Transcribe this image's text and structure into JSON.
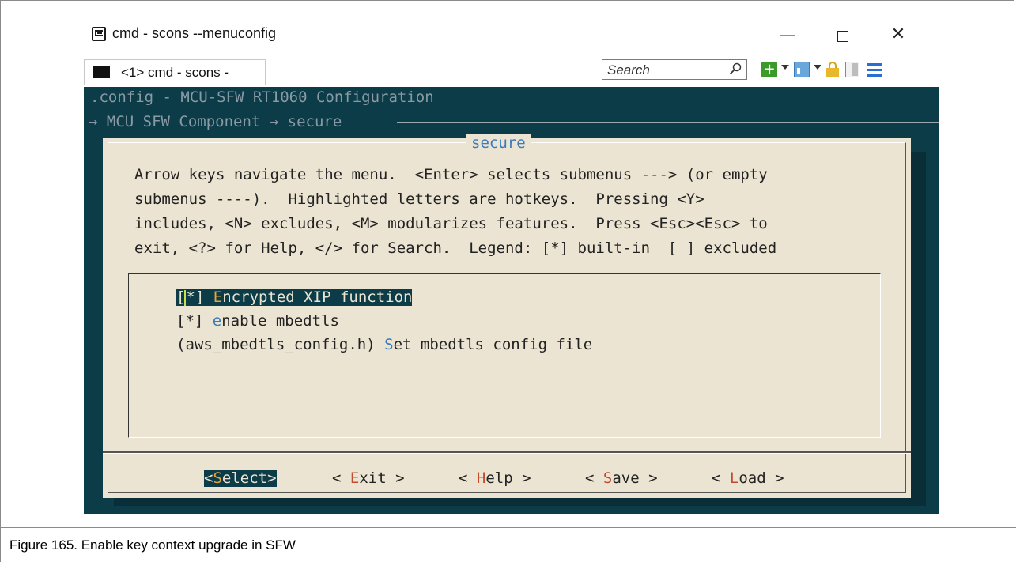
{
  "window": {
    "title": "cmd - scons  --menuconfig",
    "controls": {
      "minimize": "—",
      "maximize": "",
      "close": "✕"
    }
  },
  "tab": {
    "label": "<1>  cmd - scons  -"
  },
  "search": {
    "placeholder": "Search"
  },
  "terminal": {
    "config_line": ".config - MCU-SFW RT1060 Configuration",
    "path_line": "→ MCU SFW Component → secure",
    "dialog_title": "secure",
    "help_lines": [
      "Arrow keys navigate the menu.  <Enter> selects submenus ---> (or empty",
      "submenus ----).  Highlighted letters are hotkeys.  Pressing <Y>",
      "includes, <N> excludes, <M> modularizes features.  Press <Esc><Esc> to",
      "exit, <?> for Help, </> for Search.  Legend: [*] built-in  [ ] excluded"
    ],
    "menu_items": [
      {
        "prefix": "[*] ",
        "hotkey": "E",
        "rest": "ncrypted XIP function",
        "selected": true
      },
      {
        "prefix": "[*] ",
        "hotkey": "e",
        "rest": "nable mbedtls",
        "selected": false
      },
      {
        "prefix": "(aws_mbedtls_config.h) ",
        "hotkey": "S",
        "rest": "et mbedtls config file",
        "selected": false
      }
    ],
    "buttons": [
      {
        "open": "<",
        "hotkey": "S",
        "rest": "elect",
        "close": ">"
      },
      {
        "open": "< ",
        "hotkey": "E",
        "rest": "xit",
        "close": " >"
      },
      {
        "open": "< ",
        "hotkey": "H",
        "rest": "elp",
        "close": " >"
      },
      {
        "open": "< ",
        "hotkey": "S",
        "rest": "ave",
        "close": " >"
      },
      {
        "open": "< ",
        "hotkey": "L",
        "rest": "oad",
        "close": " >"
      }
    ]
  },
  "caption": "Figure 165. Enable key context upgrade in SFW",
  "colors": {
    "terminal_bg": "#0c3c48",
    "dialog_bg": "#ece4d2",
    "hotkey": "#c34a2c",
    "title": "#3a7bbd"
  }
}
